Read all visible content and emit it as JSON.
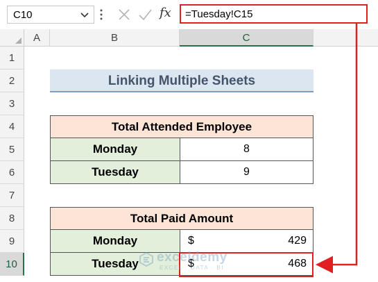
{
  "formula_bar": {
    "name_box": "C10",
    "fx_label": "fx",
    "formula": "=Tuesday!C15"
  },
  "columns": [
    "A",
    "B",
    "C"
  ],
  "selected_column": "C",
  "rows": [
    "1",
    "2",
    "3",
    "4",
    "5",
    "6",
    "7",
    "8",
    "9",
    "10"
  ],
  "selected_row": "10",
  "sheet": {
    "title": "Linking Multiple Sheets",
    "table1": {
      "header": "Total Attended Employee",
      "rows": [
        {
          "day": "Monday",
          "value": "8"
        },
        {
          "day": "Tuesday",
          "value": "9"
        }
      ]
    },
    "table2": {
      "header": "Total Paid Amount",
      "rows": [
        {
          "day": "Monday",
          "currency": "$",
          "value": "429"
        },
        {
          "day": "Tuesday",
          "currency": "$",
          "value": "468"
        }
      ]
    }
  },
  "watermark": {
    "brand": "exceldemy",
    "tagline": "EXCEL · DATA · BI"
  },
  "colors": {
    "highlight": "#e02020",
    "excel_green": "#217346",
    "title_fill": "#dce6f1",
    "header_fill": "#fce4d6",
    "label_fill": "#e2efda"
  }
}
